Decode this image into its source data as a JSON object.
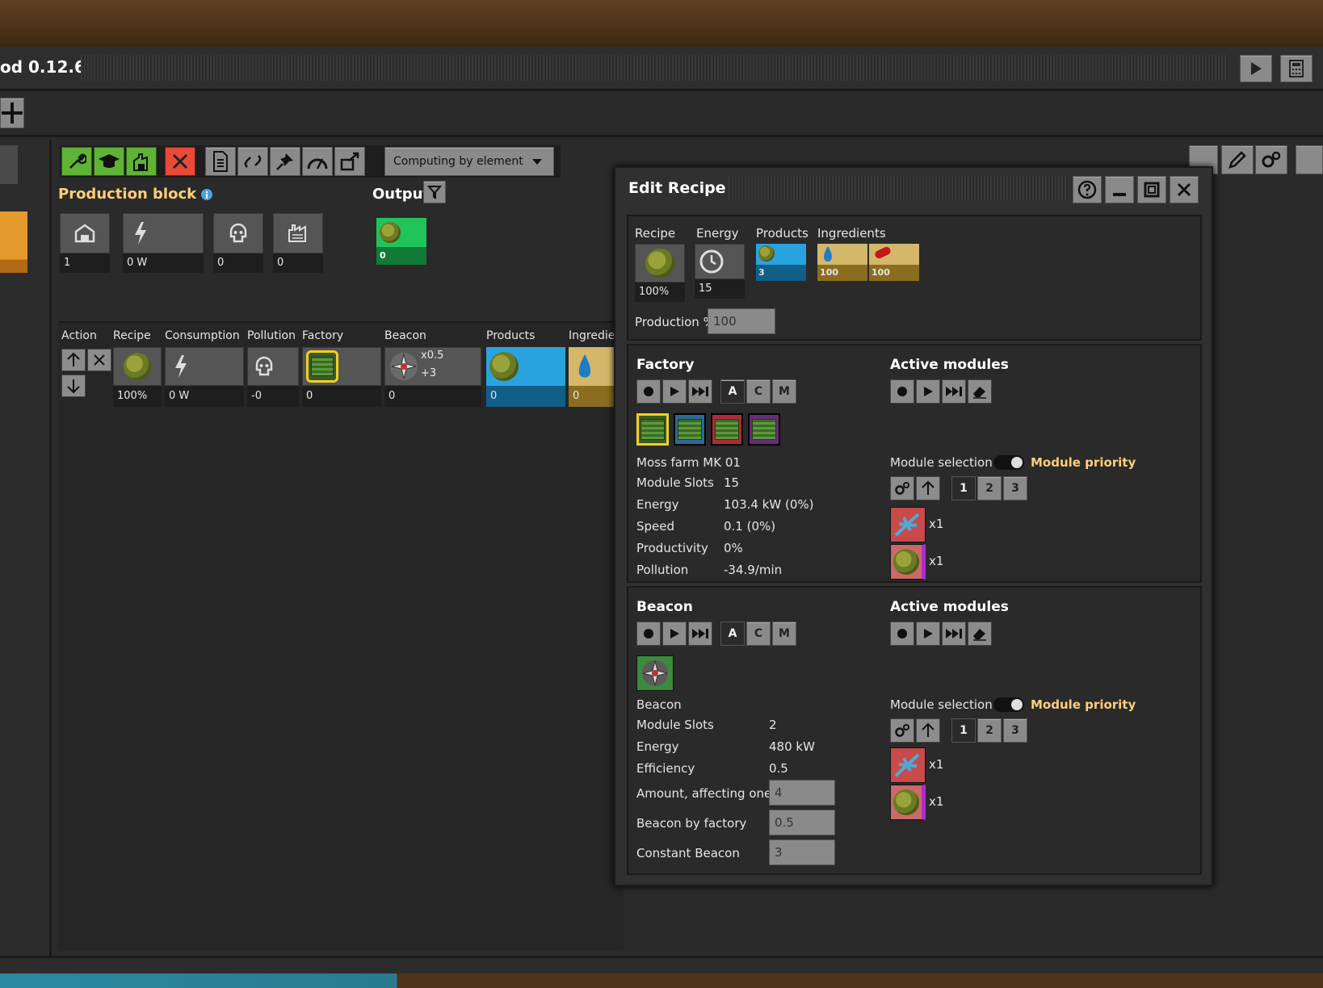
{
  "window": {
    "title": "od 0.12.6"
  },
  "toolbar": {
    "computing_mode": "Computing by element"
  },
  "production_block": {
    "title": "Production block",
    "values": [
      "1",
      "0 W",
      "0",
      "0"
    ],
    "output_label": "Output",
    "output_value": "0"
  },
  "table": {
    "headers": [
      "Action",
      "Recipe",
      "Consumption",
      "Pollution",
      "Factory",
      "Beacon",
      "Products",
      "Ingredie"
    ],
    "row": {
      "recipe_pct": "100%",
      "consumption": "0 W",
      "pollution": "-0",
      "factory": "0",
      "beacon_mult": "x0.5",
      "beacon_add": "+3",
      "beacon": "0",
      "products": "0",
      "ingredients": "0"
    }
  },
  "edit_recipe": {
    "title": "Edit Recipe",
    "summary": {
      "headers": [
        "Recipe",
        "Energy",
        "Products",
        "Ingredients"
      ],
      "recipe_pct": "100%",
      "energy": "15",
      "product_amount": "3",
      "ingredient1": "100",
      "ingredient2": "100"
    },
    "production_label": "Production %",
    "production_value": "100",
    "factory": {
      "title": "Factory",
      "buttons": [
        "A",
        "C",
        "M"
      ],
      "name": "Moss farm MK 01",
      "rows": [
        {
          "label": "Module Slots",
          "value": "15"
        },
        {
          "label": "Energy",
          "value": "103.4 kW (0%)"
        },
        {
          "label": "Speed",
          "value": "0.1 (0%)"
        },
        {
          "label": "Productivity",
          "value": "0%"
        },
        {
          "label": "Pollution",
          "value": "-34.9/min"
        }
      ]
    },
    "active_modules_title": "Active modules",
    "module_selection": "Module selection",
    "module_priority": "Module priority",
    "priority_buttons": [
      "1",
      "2",
      "3"
    ],
    "factory_modules": [
      "x1",
      "x1"
    ],
    "beacon": {
      "title": "Beacon",
      "buttons": [
        "A",
        "C",
        "M"
      ],
      "name": "Beacon",
      "rows": [
        {
          "label": "Module Slots",
          "value": "2"
        },
        {
          "label": "Energy",
          "value": "480 kW"
        },
        {
          "label": "Efficiency",
          "value": "0.5"
        }
      ],
      "inputs": [
        {
          "label": "Amount, affecting one",
          "value": "4"
        },
        {
          "label": "Beacon by factory",
          "value": "0.5"
        },
        {
          "label": "Constant Beacon",
          "value": "3"
        }
      ]
    },
    "beacon_modules": [
      "x1",
      "x1"
    ]
  }
}
